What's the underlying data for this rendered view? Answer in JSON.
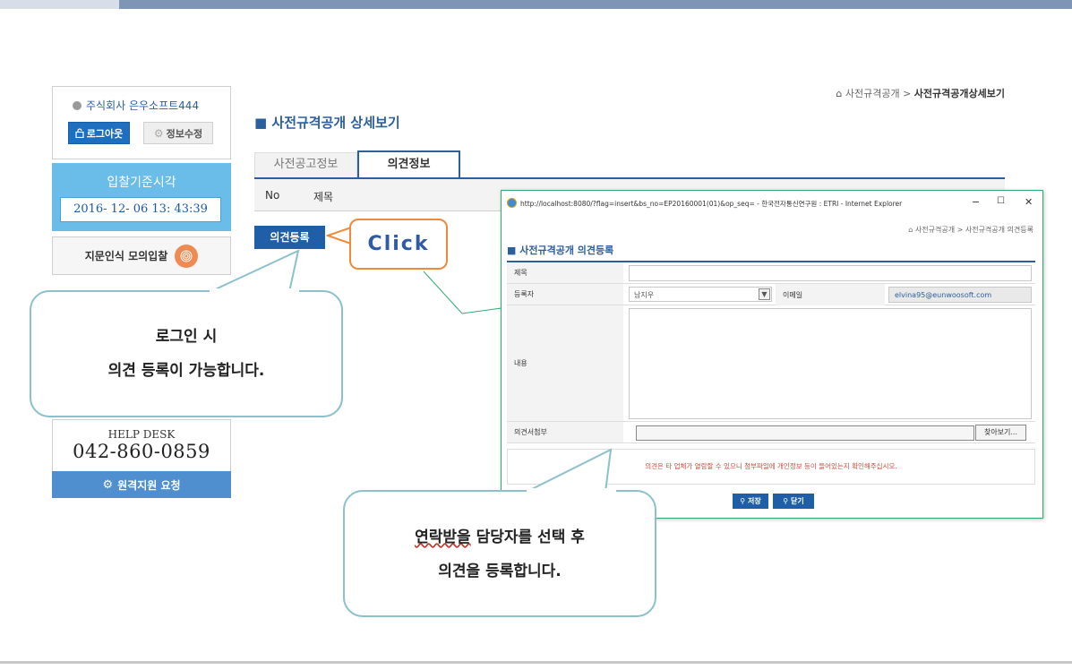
{
  "sidebar": {
    "company": "주식회사 은우소프트444",
    "logout_label": "로그아웃",
    "edit_label": "정보수정",
    "time_label": "입찰기준시각",
    "time_value": "2016- 12- 06  13: 43:39",
    "fingerprint_label": "지문인식 모의입찰",
    "help_title": "HELP DESK",
    "help_phone": "042-860-0859",
    "remote_label": "원격지원 요청"
  },
  "header": {
    "breadcrumb_parent": "사전규격공개",
    "breadcrumb_sep": " > ",
    "breadcrumb_current": "사전규격공개상세보기",
    "page_title": "■ 사전규격공개 상세보기"
  },
  "tabs": [
    {
      "label": "사전공고정보",
      "active": false
    },
    {
      "label": "의견정보",
      "active": true
    }
  ],
  "table": {
    "columns": [
      "No",
      "제목"
    ]
  },
  "main": {
    "register_button": "의견등록"
  },
  "callouts": {
    "click": "Click",
    "bubble1_line1": "로그인 시",
    "bubble1_line2": "의견 등록이 가능합니다.",
    "bubble2_line1_a": "연락받을",
    "bubble2_line1_b": " 담당자를 선택 후",
    "bubble2_line2": "의견을 등록합니다."
  },
  "popup": {
    "window_title": "http://localhost:8080/?flag=insert&bs_no=EP20160001(01)&op_seq= - 한국전자통신연구원 : ETRI - Internet Explorer",
    "breadcrumb": "사전규격공개 > 사전규격공개 의견등록",
    "title": "■ 사전규격공개 의견등록",
    "field_title": "제목",
    "field_registrant": "등록자",
    "registrant_value": "남지우",
    "field_email": "이메일",
    "email_value": "elvina95@eunwoosoft.com",
    "field_content": "내용",
    "field_attach": "의견서첨부",
    "browse_button": "찾아보기...",
    "notice": "의견은 타 업체가 열람할 수 있으니 첨부파일에 개인정보 등이 들어있는지 확인해주십시오.",
    "save_button": "저장",
    "close_button": "닫기",
    "minimize": "−",
    "maximize": "☐",
    "close_x": "✕"
  },
  "colors": {
    "accent": "#2c5f9e",
    "button_blue": "#1f5fa8",
    "time_bg": "#6bbde9",
    "callout_orange": "#f08a3a",
    "bubble_border": "#8bc0cd",
    "popup_border": "#2eaa75",
    "notice_red": "#d14b3a"
  }
}
